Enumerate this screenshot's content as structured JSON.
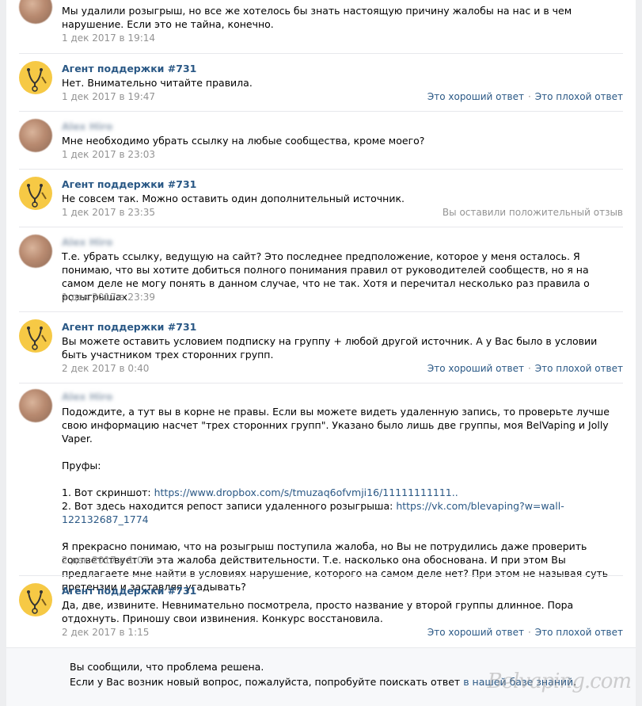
{
  "colors": {
    "link": "#2a5885",
    "meta": "#939393",
    "agent_avatar": "#f6c945"
  },
  "messages": [
    {
      "author": "",
      "text": [
        "Мы удалили розыгрыш, но все же хотелось бы знать настоящую причину жалобы на нас и в чем нарушение. Если это не тайна, конечно."
      ],
      "date": "1 дек 2017 в 19:14"
    },
    {
      "author": "Агент поддержки #731",
      "text": [
        "Нет. Внимательно читайте правила."
      ],
      "date": "1 дек 2017 в 19:47",
      "good": "Это хороший ответ",
      "bad": "Это плохой ответ"
    },
    {
      "author": "Alex Hiro",
      "text": [
        "Мне необходимо убрать ссылку на любые сообщества, кроме моего?"
      ],
      "date": "1 дек 2017 в 23:03"
    },
    {
      "author": "Агент поддержки #731",
      "text": [
        "Не совсем так. Можно оставить один дополнительный источник."
      ],
      "date": "1 дек 2017 в 23:35",
      "rated": "Вы оставили положительный отзыв"
    },
    {
      "author": "Alex Hiro",
      "text": [
        "Т.е. убрать ссылку, ведущую на сайт? Это последнее предположение, которое у меня осталось. Я понимаю, что вы хотите добиться полного понимания правил от руководителей сообществ, но я на самом деле не могу понять в данном случае, что не так. Хотя и перечитал несколько раз правила о розыгрышах."
      ],
      "date": "1 дек 2017 в 23:39"
    },
    {
      "author": "Агент поддержки #731",
      "text": [
        "Вы можете оставить условием подписку на группу + любой другой источник. А у Вас было в условии быть участником трех сторонних групп."
      ],
      "date": "2 дек 2017 в 0:40",
      "good": "Это хороший ответ",
      "bad": "Это плохой ответ"
    },
    {
      "author": "Alex Hiro",
      "p1": "Подождите, а тут вы в корне не правы. Если вы можете видеть удаленную запись, то проверьте лучше свою информацию насчет \"трех сторонних групп\". Указано было лишь две группы, моя BelVaping и Jolly Vaper.",
      "p2": "Пруфы:",
      "l1_prefix": "1. Вот скриншот: ",
      "l1_link": "https://www.dropbox.com/s/tmuzaq6ofvmji16/11111111111..",
      "l2_prefix": "2. Вот здесь находится репост записи удаленного розыгрыша: ",
      "l2_link": "https://vk.com/blevaping?w=wall-122132687_1774",
      "p3": "Я прекрасно понимаю, что на розыгрыш поступила жалоба, но Вы не потрудились даже проверить соответствует ли эта жалоба действительности. Т.е. насколько она обоснована. И при этом Вы предлагаете мне найти в условиях нарушение, которого на самом деле нет? При этом не называя суть претензии и заставляя угадывать?",
      "date": "2 дек 2017 в 1:07"
    },
    {
      "author": "Агент поддержки #731",
      "text": [
        "Да, две, извините. Невнимательно посмотрела, просто название у второй группы длинное. Пора отдохнуть. Приношу свои извинения. Конкурс восстановила."
      ],
      "date": "2 дек 2017 в 1:15",
      "good": "Это хороший ответ",
      "bad": "Это плохой ответ"
    }
  ],
  "footer": {
    "line1": "Вы сообщили, что проблема решена.",
    "line2_prefix": "Если у Вас возник новый вопрос, пожалуйста, попробуйте поискать ответ ",
    "line2_link": "в нашей базе знаний",
    "line2_suffix": "."
  },
  "watermark": "Belvaping.com"
}
